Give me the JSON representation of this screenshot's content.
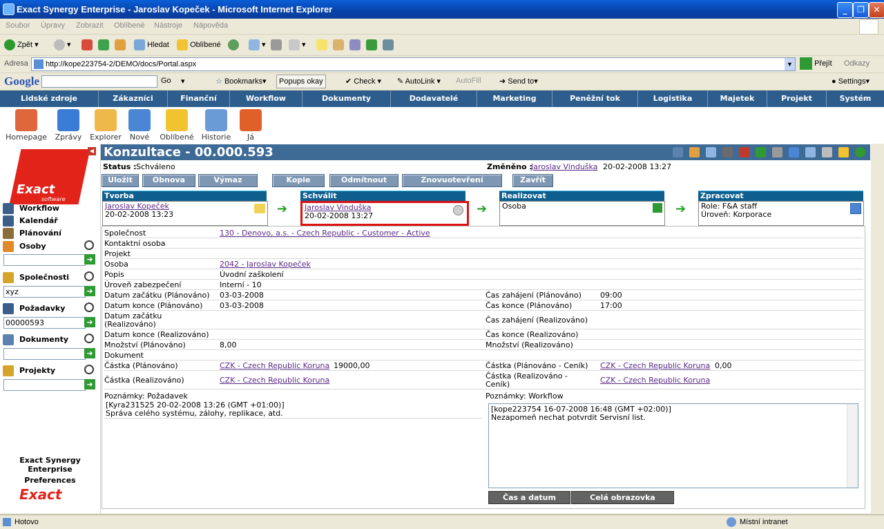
{
  "window": {
    "title": "Exact Synergy Enterprise - Jaroslav Kopeček - Microsoft Internet Explorer"
  },
  "menu": [
    "Soubor",
    "Úpravy",
    "Zobrazit",
    "Oblíbené",
    "Nástroje",
    "Nápověda"
  ],
  "toolbar": {
    "back": "Zpět",
    "search": "Hledat",
    "favorites": "Oblíbené"
  },
  "address": {
    "label": "Adresa",
    "url": "http://kope223754-2/DEMO/docs/Portal.aspx",
    "go": "Přejít",
    "links": "Odkazy"
  },
  "google": {
    "go": "Go",
    "bookmarks": "Bookmarks",
    "popups": "Popups okay",
    "check": "Check",
    "autolink": "AutoLink",
    "autofill": "AutoFill",
    "sendto": "Send to",
    "settings": "Settings"
  },
  "modules": [
    "Lidské zdroje",
    "Zákazníci",
    "Finanční",
    "Workflow",
    "Dokumenty",
    "Dodavatelé",
    "Marketing",
    "Peněžní tok",
    "Logistika",
    "Majetek",
    "Projekt",
    "Systém"
  ],
  "icons": [
    "Homepage",
    "Zprávy",
    "Explorer",
    "Nové",
    "Oblíbené",
    "Historie",
    "Já"
  ],
  "sidebar": {
    "logo_text": "Exact",
    "logo_sub": "software",
    "workflow": "Workflow",
    "calendar": "Kalendář",
    "planning": "Plánování",
    "persons": "Osoby",
    "persons_value": "",
    "companies": "Společnosti",
    "companies_value": "xyz",
    "requests": "Požadavky",
    "requests_value": "00000593",
    "documents": "Dokumenty",
    "documents_value": "",
    "projects": "Projekty",
    "projects_value": "",
    "footer1": "Exact Synergy",
    "footer2": "Enterprise",
    "footer3": "Preferences"
  },
  "page": {
    "title": "Konzultace - 00.000.593",
    "status_label": "Status :",
    "status_value": "Schváleno",
    "changed_label": "Změněno :",
    "changed_by": "Jaroslav Vinduška",
    "changed_at": "20-02-2008 13:27"
  },
  "actions": [
    "Uložit",
    "Obnova",
    "Výmaz",
    "Kopie",
    "Odmítnout",
    "Znovuotevření",
    "Zavřít"
  ],
  "stages": {
    "s1": {
      "head": "Tvorba",
      "line1": "Jaroslav Kopeček",
      "line2": "20-02-2008 13:23"
    },
    "s2": {
      "head": "Schválit",
      "line1": "Jaroslav Vinduška",
      "line2": "20-02-2008 13:27"
    },
    "s3": {
      "head": "Realizovat",
      "line1": "Osoba",
      "line2": ""
    },
    "s4": {
      "head": "Zpracovat",
      "line1": "Role: F&A staff",
      "line2": "Úroveň: Korporace"
    }
  },
  "fields": {
    "company_l": "Společnost",
    "company_v": "130 - Denovo, a.s. - Czech Republic - Customer - Active",
    "contact_l": "Kontaktní osoba",
    "project_l": "Projekt",
    "person_l": "Osoba",
    "person_v": "2042 - Jaroslav Kopeček",
    "desc_l": "Popis",
    "desc_v": "Úvodní zaškolení",
    "security_l": "Úroveň zabezpečení",
    "security_v": "Interní - 10",
    "startp_l": "Datum začátku (Plánováno)",
    "startp_v": "03-03-2008",
    "endp_l": "Datum konce (Plánováno)",
    "endp_v": "03-03-2008",
    "startr_l1": "Datum začátku",
    "startr_l2": "(Realizováno)",
    "endr_l": "Datum konce (Realizováno)",
    "qtyp_l": "Množství (Plánováno)",
    "qtyp_v": "8,00",
    "doc_l": "Dokument",
    "amtp_l": "Částka (Plánováno)",
    "amtp_cur": "CZK - Czech Republic Koruna",
    "amtp_v": "19000,00",
    "amtr_l": "Částka (Realizováno)",
    "amtr_cur": "CZK - Czech Republic Koruna",
    "tstartp_l": "Čas zahájení (Plánováno)",
    "tstartp_v": "09:00",
    "tendp_l": "Čas konce (Plánováno)",
    "tendp_v": "17:00",
    "tstartr_l": "Čas zahájení (Realizováno)",
    "tendr_l": "Čas konce (Realizováno)",
    "qtyr_l": "Množství (Realizováno)",
    "amtpl_l": "Částka (Plánováno - Ceník)",
    "amtpl_cur": "CZK - Czech Republic Koruna",
    "amtpl_v": "0,00",
    "amtrl_l1": "Částka (Realizováno -",
    "amtrl_l2": "Ceník)",
    "amtrl_cur": "CZK - Czech Republic Koruna",
    "notes_req_l": "Poznámky: Požadavek",
    "notes_req_1": "[Kyra231525 20-02-2008 13:26 (GMT +01:00)]",
    "notes_req_2": "Správa celého systému, zálohy, replikace, atd.",
    "notes_wf_l": "Poznámky: Workflow",
    "notes_wf_1": "[kope223754 16-07-2008 16:48 (GMT +02:00)]",
    "notes_wf_2": "Nezapomeň nechat potvrdit Servisní list."
  },
  "bottom_buttons": {
    "datetime": "Čas a datum",
    "fullscreen": "Celá obrazovka"
  },
  "statusbar": {
    "left": "Hotovo",
    "right": "Místní intranet"
  }
}
